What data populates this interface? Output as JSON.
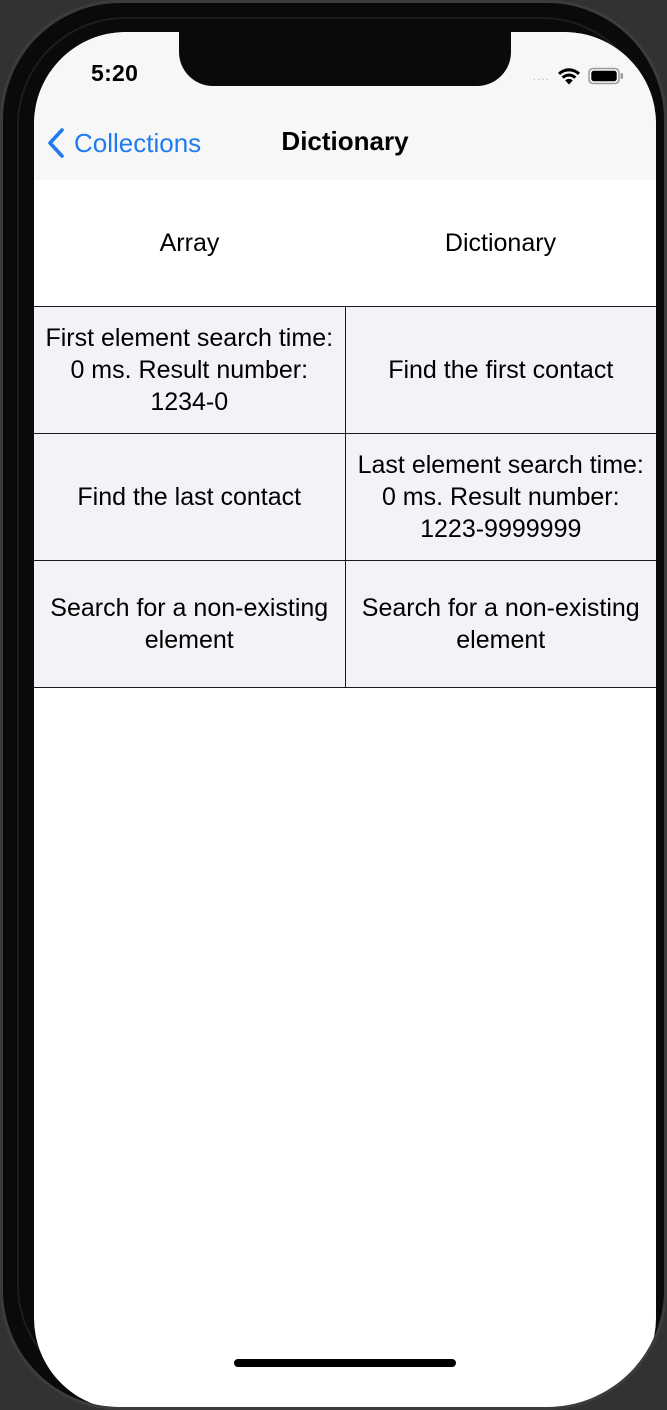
{
  "status_bar": {
    "time": "5:20",
    "signal_dots": "....",
    "icons": [
      "wifi-icon",
      "battery-icon"
    ]
  },
  "nav": {
    "back_label": "Collections",
    "title": "Dictionary"
  },
  "table": {
    "headers": [
      "Array",
      "Dictionary"
    ],
    "rows": [
      {
        "left": "First element search time: 0 ms. Result number: 1234-0",
        "right": "Find the first contact"
      },
      {
        "left": "Find the last contact",
        "right": "Last element search time: 0 ms. Result number: 1223-9999999"
      },
      {
        "left": "Search for a non-existing element",
        "right": "Search for a non-existing element"
      }
    ]
  },
  "colors": {
    "accent": "#1f7cf0",
    "cell_background": "#f2f2f7",
    "grid_line": "#1a1a1a"
  }
}
